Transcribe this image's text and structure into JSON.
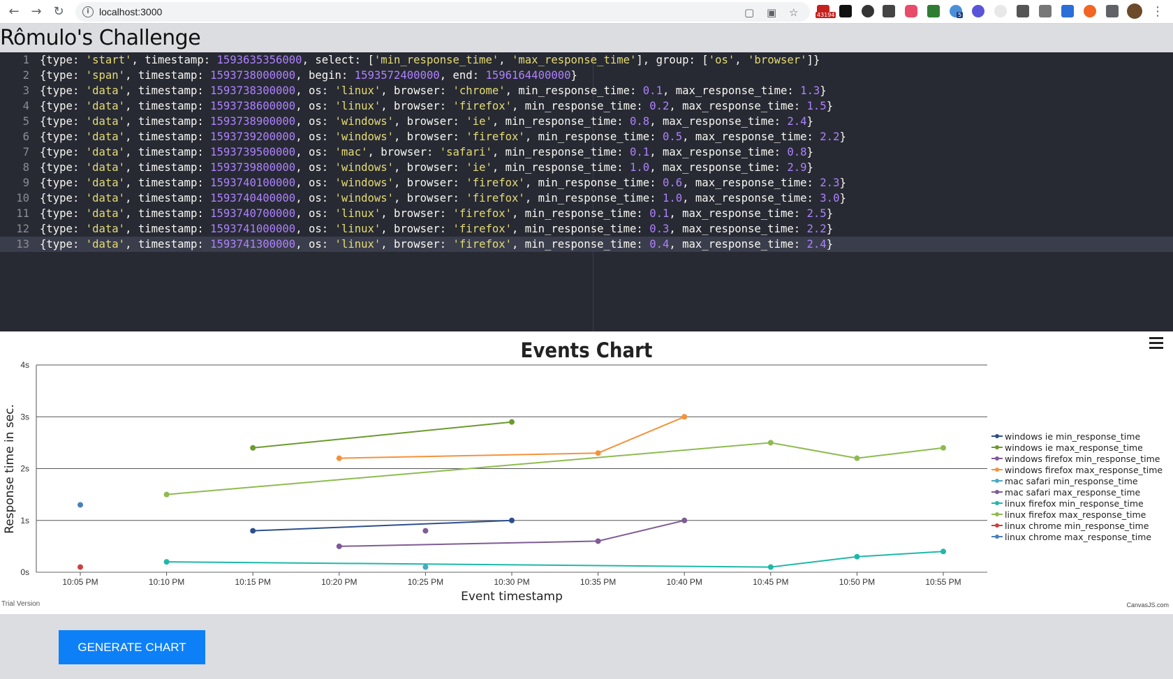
{
  "browser": {
    "url": "localhost:3000",
    "gmail_badge": "43194",
    "ext_badge_5": "5"
  },
  "page": {
    "title": "Rômulo's Challenge",
    "button_label": "GENERATE CHART"
  },
  "editor": {
    "active_line": 13,
    "lines": [
      [
        [
          "t",
          "{type: "
        ],
        [
          "s",
          "'start'"
        ],
        [
          "t",
          ", timestamp: "
        ],
        [
          "n",
          "1593635356000"
        ],
        [
          "t",
          ", select: ["
        ],
        [
          "s",
          "'min_response_time'"
        ],
        [
          "t",
          ", "
        ],
        [
          "s",
          "'max_response_time'"
        ],
        [
          "t",
          "], group: ["
        ],
        [
          "s",
          "'os'"
        ],
        [
          "t",
          ", "
        ],
        [
          "s",
          "'browser'"
        ],
        [
          "t",
          "]}"
        ]
      ],
      [
        [
          "t",
          "{type: "
        ],
        [
          "s",
          "'span'"
        ],
        [
          "t",
          ", timestamp: "
        ],
        [
          "n",
          "1593738000000"
        ],
        [
          "t",
          ", begin: "
        ],
        [
          "n",
          "1593572400000"
        ],
        [
          "t",
          ", end: "
        ],
        [
          "n",
          "1596164400000"
        ],
        [
          "t",
          "}"
        ]
      ],
      [
        [
          "t",
          "{type: "
        ],
        [
          "s",
          "'data'"
        ],
        [
          "t",
          ", timestamp: "
        ],
        [
          "n",
          "1593738300000"
        ],
        [
          "t",
          ", os: "
        ],
        [
          "s",
          "'linux'"
        ],
        [
          "t",
          ", browser: "
        ],
        [
          "s",
          "'chrome'"
        ],
        [
          "t",
          ", min_response_time: "
        ],
        [
          "n",
          "0.1"
        ],
        [
          "t",
          ", max_response_time: "
        ],
        [
          "n",
          "1.3"
        ],
        [
          "t",
          "}"
        ]
      ],
      [
        [
          "t",
          "{type: "
        ],
        [
          "s",
          "'data'"
        ],
        [
          "t",
          ", timestamp: "
        ],
        [
          "n",
          "1593738600000"
        ],
        [
          "t",
          ", os: "
        ],
        [
          "s",
          "'linux'"
        ],
        [
          "t",
          ", browser: "
        ],
        [
          "s",
          "'firefox'"
        ],
        [
          "t",
          ", min_response_time: "
        ],
        [
          "n",
          "0.2"
        ],
        [
          "t",
          ", max_response_time: "
        ],
        [
          "n",
          "1.5"
        ],
        [
          "t",
          "}"
        ]
      ],
      [
        [
          "t",
          "{type: "
        ],
        [
          "s",
          "'data'"
        ],
        [
          "t",
          ", timestamp: "
        ],
        [
          "n",
          "1593738900000"
        ],
        [
          "t",
          ", os: "
        ],
        [
          "s",
          "'windows'"
        ],
        [
          "t",
          ", browser: "
        ],
        [
          "s",
          "'ie'"
        ],
        [
          "t",
          ", min_response_time: "
        ],
        [
          "n",
          "0.8"
        ],
        [
          "t",
          ", max_response_time: "
        ],
        [
          "n",
          "2.4"
        ],
        [
          "t",
          "}"
        ]
      ],
      [
        [
          "t",
          "{type: "
        ],
        [
          "s",
          "'data'"
        ],
        [
          "t",
          ", timestamp: "
        ],
        [
          "n",
          "1593739200000"
        ],
        [
          "t",
          ", os: "
        ],
        [
          "s",
          "'windows'"
        ],
        [
          "t",
          ", browser: "
        ],
        [
          "s",
          "'firefox'"
        ],
        [
          "t",
          ", min_response_time: "
        ],
        [
          "n",
          "0.5"
        ],
        [
          "t",
          ", max_response_time: "
        ],
        [
          "n",
          "2.2"
        ],
        [
          "t",
          "}"
        ]
      ],
      [
        [
          "t",
          "{type: "
        ],
        [
          "s",
          "'data'"
        ],
        [
          "t",
          ", timestamp: "
        ],
        [
          "n",
          "1593739500000"
        ],
        [
          "t",
          ", os: "
        ],
        [
          "s",
          "'mac'"
        ],
        [
          "t",
          ", browser: "
        ],
        [
          "s",
          "'safari'"
        ],
        [
          "t",
          ", min_response_time: "
        ],
        [
          "n",
          "0.1"
        ],
        [
          "t",
          ", max_response_time: "
        ],
        [
          "n",
          "0.8"
        ],
        [
          "t",
          "}"
        ]
      ],
      [
        [
          "t",
          "{type: "
        ],
        [
          "s",
          "'data'"
        ],
        [
          "t",
          ", timestamp: "
        ],
        [
          "n",
          "1593739800000"
        ],
        [
          "t",
          ", os: "
        ],
        [
          "s",
          "'windows'"
        ],
        [
          "t",
          ", browser: "
        ],
        [
          "s",
          "'ie'"
        ],
        [
          "t",
          ", min_response_time: "
        ],
        [
          "n",
          "1.0"
        ],
        [
          "t",
          ", max_response_time: "
        ],
        [
          "n",
          "2.9"
        ],
        [
          "t",
          "}"
        ]
      ],
      [
        [
          "t",
          "{type: "
        ],
        [
          "s",
          "'data'"
        ],
        [
          "t",
          ", timestamp: "
        ],
        [
          "n",
          "1593740100000"
        ],
        [
          "t",
          ", os: "
        ],
        [
          "s",
          "'windows'"
        ],
        [
          "t",
          ", browser: "
        ],
        [
          "s",
          "'firefox'"
        ],
        [
          "t",
          ", min_response_time: "
        ],
        [
          "n",
          "0.6"
        ],
        [
          "t",
          ", max_response_time: "
        ],
        [
          "n",
          "2.3"
        ],
        [
          "t",
          "}"
        ]
      ],
      [
        [
          "t",
          "{type: "
        ],
        [
          "s",
          "'data'"
        ],
        [
          "t",
          ", timestamp: "
        ],
        [
          "n",
          "1593740400000"
        ],
        [
          "t",
          ", os: "
        ],
        [
          "s",
          "'windows'"
        ],
        [
          "t",
          ", browser: "
        ],
        [
          "s",
          "'firefox'"
        ],
        [
          "t",
          ", min_response_time: "
        ],
        [
          "n",
          "1.0"
        ],
        [
          "t",
          ", max_response_time: "
        ],
        [
          "n",
          "3.0"
        ],
        [
          "t",
          "}"
        ]
      ],
      [
        [
          "t",
          "{type: "
        ],
        [
          "s",
          "'data'"
        ],
        [
          "t",
          ", timestamp: "
        ],
        [
          "n",
          "1593740700000"
        ],
        [
          "t",
          ", os: "
        ],
        [
          "s",
          "'linux'"
        ],
        [
          "t",
          ", browser: "
        ],
        [
          "s",
          "'firefox'"
        ],
        [
          "t",
          ", min_response_time: "
        ],
        [
          "n",
          "0.1"
        ],
        [
          "t",
          ", max_response_time: "
        ],
        [
          "n",
          "2.5"
        ],
        [
          "t",
          "}"
        ]
      ],
      [
        [
          "t",
          "{type: "
        ],
        [
          "s",
          "'data'"
        ],
        [
          "t",
          ", timestamp: "
        ],
        [
          "n",
          "1593741000000"
        ],
        [
          "t",
          ", os: "
        ],
        [
          "s",
          "'linux'"
        ],
        [
          "t",
          ", browser: "
        ],
        [
          "s",
          "'firefox'"
        ],
        [
          "t",
          ", min_response_time: "
        ],
        [
          "n",
          "0.3"
        ],
        [
          "t",
          ", max_response_time: "
        ],
        [
          "n",
          "2.2"
        ],
        [
          "t",
          "}"
        ]
      ],
      [
        [
          "t",
          "{type: "
        ],
        [
          "s",
          "'data'"
        ],
        [
          "t",
          ", timestamp: "
        ],
        [
          "n",
          "1593741300000"
        ],
        [
          "t",
          ", os: "
        ],
        [
          "s",
          "'linux'"
        ],
        [
          "t",
          ", browser: "
        ],
        [
          "s",
          "'firefox'"
        ],
        [
          "t",
          ", min_response_time: "
        ],
        [
          "n",
          "0.4"
        ],
        [
          "t",
          ", max_response_time: "
        ],
        [
          "n",
          "2.4"
        ],
        [
          "t",
          "}"
        ]
      ]
    ]
  },
  "chart": {
    "trial_label": "Trial Version",
    "credit_label": "CanvasJS.com"
  },
  "chart_data": {
    "type": "line",
    "title": "Events Chart",
    "xlabel": "Event timestamp",
    "ylabel": "Response time in sec.",
    "x_tick_labels": [
      "10:05 PM",
      "10:10 PM",
      "10:15 PM",
      "10:20 PM",
      "10:25 PM",
      "10:30 PM",
      "10:35 PM",
      "10:40 PM",
      "10:45 PM",
      "10:50 PM",
      "10:55 PM"
    ],
    "y_tick_labels": [
      "0s",
      "1s",
      "2s",
      "3s",
      "4s"
    ],
    "ylim": [
      0,
      4
    ],
    "grid": true,
    "legend": "right",
    "series": [
      {
        "name": "windows ie min_response_time",
        "color": "#2e4f8c",
        "points": [
          [
            "10:15 PM",
            0.8
          ],
          [
            "10:30 PM",
            1.0
          ]
        ]
      },
      {
        "name": "windows ie max_response_time",
        "color": "#6b9a2d",
        "points": [
          [
            "10:15 PM",
            2.4
          ],
          [
            "10:30 PM",
            2.9
          ]
        ]
      },
      {
        "name": "windows firefox min_response_time",
        "color": "#7e5b96",
        "points": [
          [
            "10:20 PM",
            0.5
          ],
          [
            "10:35 PM",
            0.6
          ],
          [
            "10:40 PM",
            1.0
          ]
        ]
      },
      {
        "name": "windows firefox max_response_time",
        "color": "#f4923b",
        "points": [
          [
            "10:20 PM",
            2.2
          ],
          [
            "10:35 PM",
            2.3
          ],
          [
            "10:40 PM",
            3.0
          ]
        ]
      },
      {
        "name": "mac safari min_response_time",
        "color": "#4aa8c4",
        "points": [
          [
            "10:25 PM",
            0.1
          ]
        ]
      },
      {
        "name": "mac safari max_response_time",
        "color": "#7e5b96",
        "points": [
          [
            "10:25 PM",
            0.8
          ]
        ]
      },
      {
        "name": "linux firefox min_response_time",
        "color": "#1fb8a8",
        "points": [
          [
            "10:10 PM",
            0.2
          ],
          [
            "10:45 PM",
            0.1
          ],
          [
            "10:50 PM",
            0.3
          ],
          [
            "10:55 PM",
            0.4
          ]
        ]
      },
      {
        "name": "linux firefox max_response_time",
        "color": "#8ebb4f",
        "points": [
          [
            "10:10 PM",
            1.5
          ],
          [
            "10:45 PM",
            2.5
          ],
          [
            "10:50 PM",
            2.2
          ],
          [
            "10:55 PM",
            2.4
          ]
        ]
      },
      {
        "name": "linux chrome min_response_time",
        "color": "#c9433f",
        "points": [
          [
            "10:05 PM",
            0.1
          ]
        ]
      },
      {
        "name": "linux chrome max_response_time",
        "color": "#4a7fb8",
        "points": [
          [
            "10:05 PM",
            1.3
          ]
        ]
      }
    ]
  }
}
